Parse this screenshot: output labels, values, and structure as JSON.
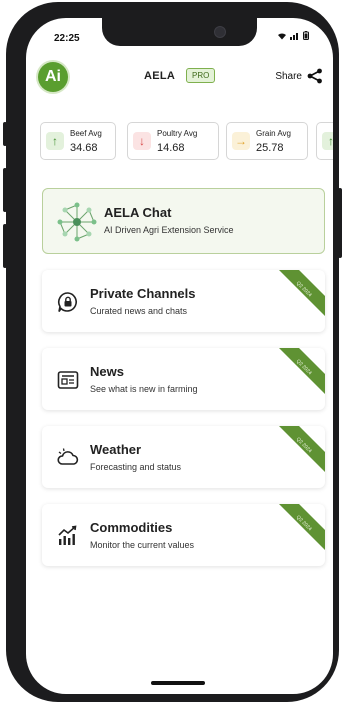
{
  "status_bar": {
    "time": "22:25"
  },
  "header": {
    "logo_text": "Ai",
    "title": "AELA",
    "badge": "PRO",
    "share_label": "Share"
  },
  "tickers": [
    {
      "label": "Beef Avg",
      "value": "34.68",
      "trend": "up",
      "color": "#3f8f2f",
      "bg": "#e3f1dc"
    },
    {
      "label": "Poultry Avg",
      "value": "14.68",
      "trend": "down",
      "color": "#d94848",
      "bg": "#fbe3e3"
    },
    {
      "label": "Grain Avg",
      "value": "25.78",
      "trend": "right",
      "color": "#e0a12a",
      "bg": "#fbf1d8"
    },
    {
      "label": "",
      "value": "",
      "trend": "up",
      "color": "#3f8f2f",
      "bg": "#e3f1dc"
    }
  ],
  "chat": {
    "title": "AELA Chat",
    "subtitle": "AI Driven Agri Extension Service"
  },
  "cards": [
    {
      "title": "Private Channels",
      "subtitle": "Curated news and chats",
      "ribbon": "Q2 2024",
      "icon": "chat-lock-icon"
    },
    {
      "title": "News",
      "subtitle": "See what is new in farming",
      "ribbon": "Q2 2024",
      "icon": "newspaper-icon"
    },
    {
      "title": "Weather",
      "subtitle": "Forecasting and status",
      "ribbon": "Q2 2024",
      "icon": "cloud-icon"
    },
    {
      "title": "Commodities",
      "subtitle": "Monitor the current values",
      "ribbon": "Q2 2024",
      "icon": "chart-icon"
    }
  ],
  "colors": {
    "brand": "#5a9e2f",
    "ribbon": "#5f9233"
  }
}
